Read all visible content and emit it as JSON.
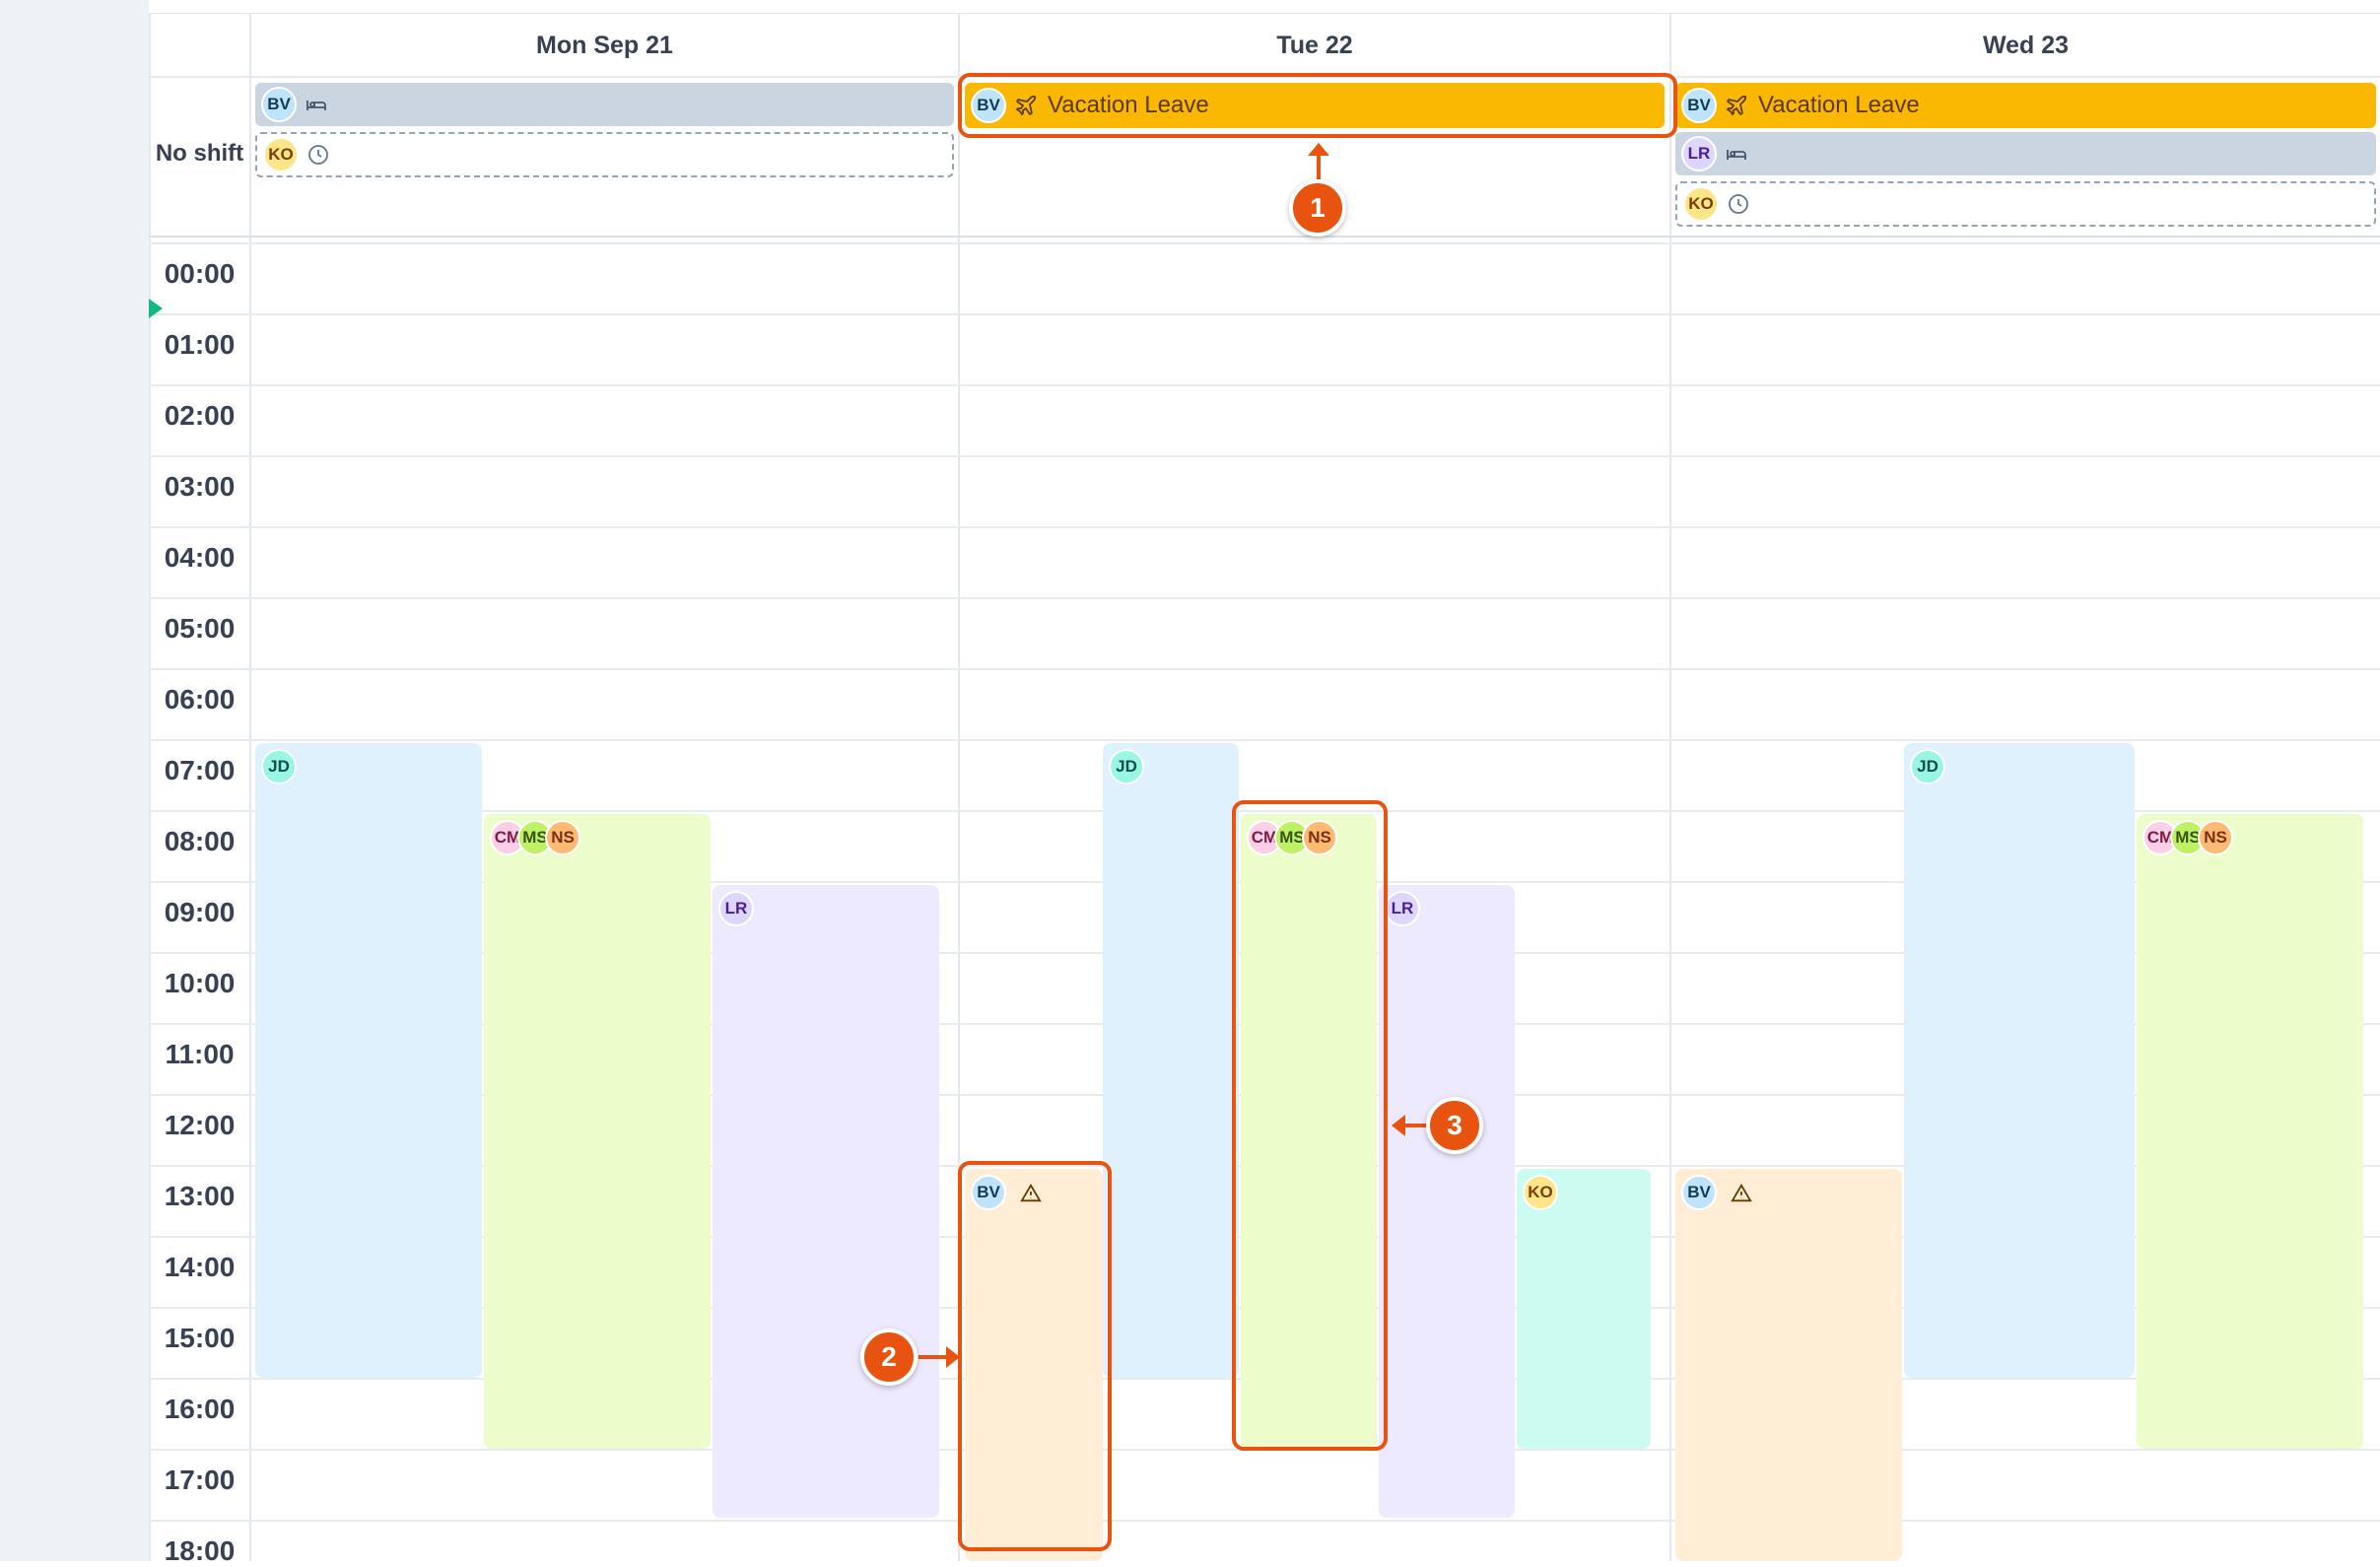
{
  "days": [
    {
      "label": "Mon Sep 21"
    },
    {
      "label": "Tue 22"
    },
    {
      "label": "Wed 23"
    }
  ],
  "no_shift_label": "No shift",
  "hours": [
    "00:00",
    "01:00",
    "02:00",
    "03:00",
    "04:00",
    "05:00",
    "06:00",
    "07:00",
    "08:00",
    "09:00",
    "10:00",
    "11:00",
    "12:00",
    "13:00",
    "14:00",
    "15:00",
    "16:00",
    "17:00",
    "18:00"
  ],
  "no_shift_entries": {
    "mon": [
      {
        "initials": "BV",
        "icon": "bed-icon"
      },
      {
        "initials": "KO",
        "icon": "clock-icon"
      }
    ],
    "tue": [
      {
        "initials": "BV",
        "icon": "plane-icon",
        "label": "Vacation Leave"
      }
    ],
    "wed": [
      {
        "initials": "BV",
        "icon": "plane-icon",
        "label": "Vacation Leave"
      },
      {
        "initials": "LR",
        "icon": "bed-icon"
      },
      {
        "initials": "KO",
        "icon": "clock-icon"
      }
    ]
  },
  "shifts": {
    "mon": [
      {
        "people": [
          "JD"
        ],
        "color": "#dff1fd"
      },
      {
        "people": [
          "CM",
          "MS",
          "NS"
        ],
        "color": "#ecfccb"
      },
      {
        "people": [
          "LR"
        ],
        "color": "#ede9fe"
      }
    ],
    "tue": [
      {
        "people": [
          "BV"
        ],
        "icon": "warning-icon",
        "color": "#ffedd5"
      },
      {
        "people": [
          "JD"
        ],
        "color": "#dff1fd"
      },
      {
        "people": [
          "CM",
          "MS",
          "NS"
        ],
        "color": "#ecfccb"
      },
      {
        "people": [
          "LR"
        ],
        "color": "#ede9fe"
      },
      {
        "people": [
          "KO"
        ],
        "color": "#ccfbf1"
      }
    ],
    "wed": [
      {
        "people": [
          "BV"
        ],
        "icon": "warning-icon",
        "color": "#ffedd5"
      },
      {
        "people": [
          "JD"
        ],
        "color": "#dff1fd"
      },
      {
        "people": [
          "CM",
          "MS",
          "NS"
        ],
        "color": "#ecfccb"
      }
    ]
  },
  "callouts": [
    "1",
    "2",
    "3"
  ],
  "accent_color": "#e8530f"
}
